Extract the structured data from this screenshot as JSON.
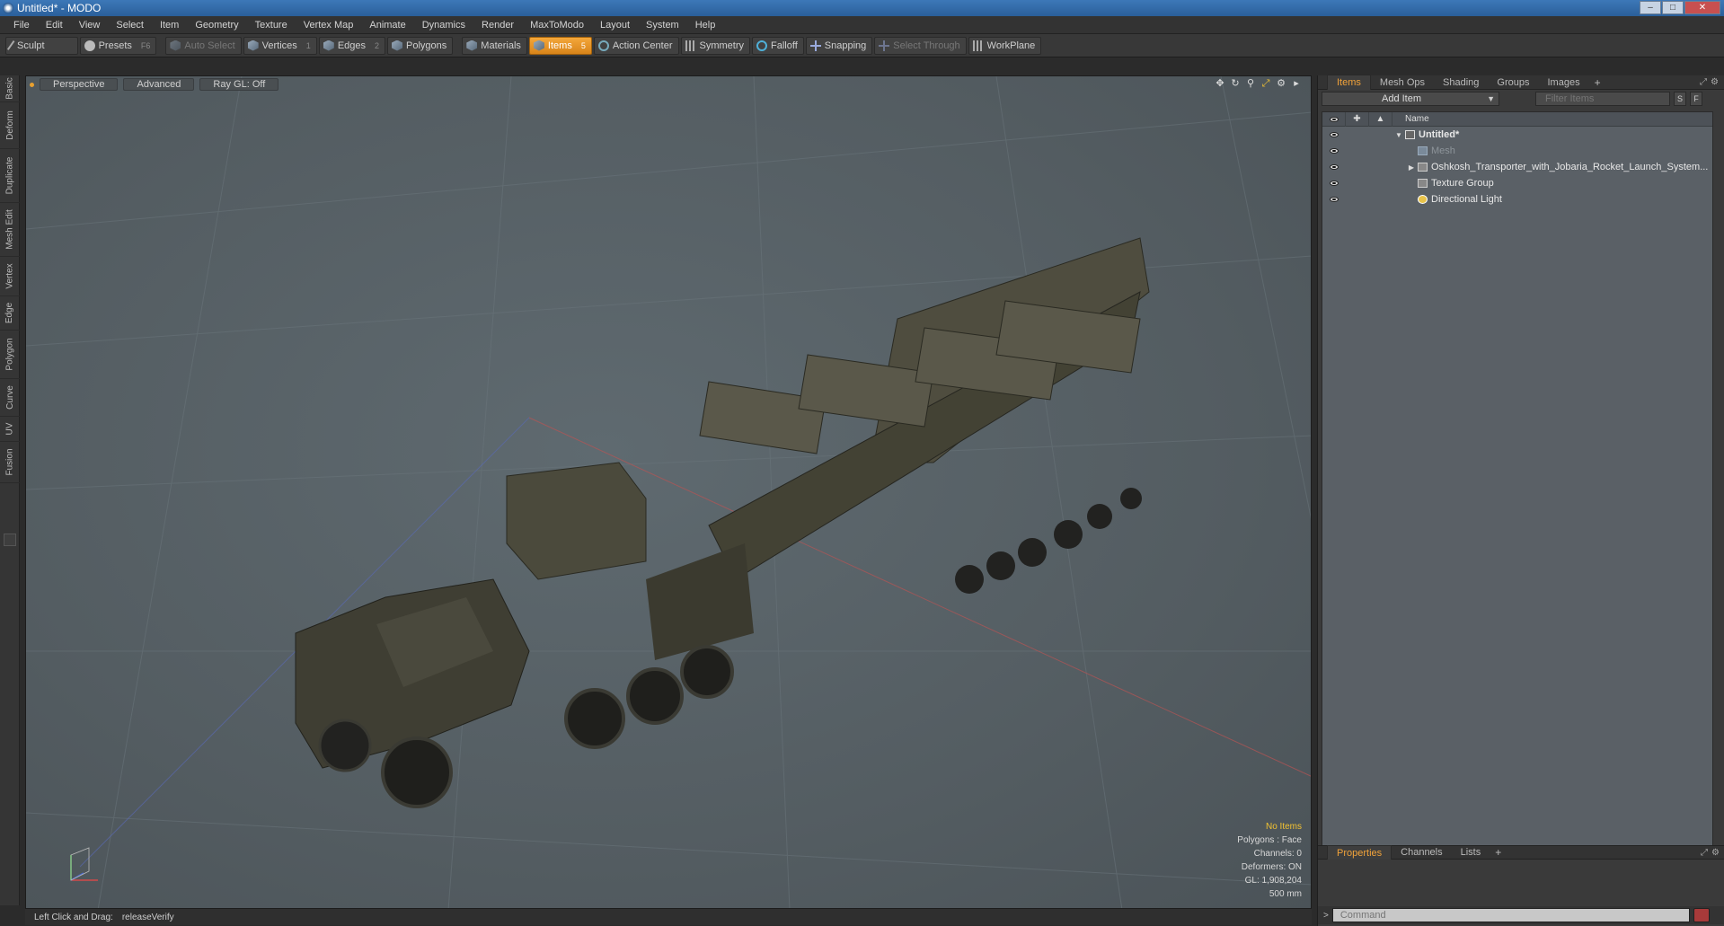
{
  "window": {
    "title": "Untitled* - MODO"
  },
  "menu": [
    "File",
    "Edit",
    "View",
    "Select",
    "Item",
    "Geometry",
    "Texture",
    "Vertex Map",
    "Animate",
    "Dynamics",
    "Render",
    "MaxToModo",
    "Layout",
    "System",
    "Help"
  ],
  "toolbar": {
    "sculpt": "Sculpt",
    "presets": "Presets",
    "presets_key": "F6",
    "auto_select": "Auto Select",
    "vertices": "Vertices",
    "vertices_key": "1",
    "edges": "Edges",
    "edges_key": "2",
    "polygons": "Polygons",
    "materials": "Materials",
    "items": "Items",
    "items_key": "5",
    "action_center": "Action Center",
    "symmetry": "Symmetry",
    "falloff": "Falloff",
    "snapping": "Snapping",
    "select_through": "Select Through",
    "workplane": "WorkPlane"
  },
  "left_tabs": [
    "Basic",
    "Deform",
    "Duplicate",
    "Mesh Edit",
    "Vertex",
    "Edge",
    "Polygon",
    "Curve",
    "UV",
    "Fusion"
  ],
  "viewport": {
    "view": "Perspective",
    "shading": "Advanced",
    "raygl": "Ray GL: Off",
    "stats": {
      "selection": "No Items",
      "polygons": "Polygons : Face",
      "channels": "Channels: 0",
      "deformers": "Deformers: ON",
      "gl": "GL: 1,908,204",
      "scale": "500 mm"
    }
  },
  "status": {
    "hint": "Left Click and Drag:",
    "action": "releaseVerify"
  },
  "panel": {
    "tabs": [
      "Items",
      "Mesh Ops",
      "Shading",
      "Groups",
      "Images"
    ],
    "add_item": "Add Item",
    "filter_placeholder": "Filter Items",
    "s_btn": "S",
    "f_btn": "F",
    "name_header": "Name",
    "tree": [
      {
        "label": "Untitled*"
      },
      {
        "label": "Mesh"
      },
      {
        "label": "Oshkosh_Transporter_with_Jobaria_Rocket_Launch_System..."
      },
      {
        "label": "Texture Group"
      },
      {
        "label": "Directional Light"
      }
    ],
    "bottom_tabs": [
      "Properties",
      "Channels",
      "Lists"
    ],
    "command_placeholder": "Command"
  },
  "colors": {
    "accent": "#f2a33a",
    "viewport_bg": "#5a6368",
    "x_axis": "#d24a4a",
    "y_axis": "#4ad24a",
    "z_axis": "#4a6ad2"
  }
}
